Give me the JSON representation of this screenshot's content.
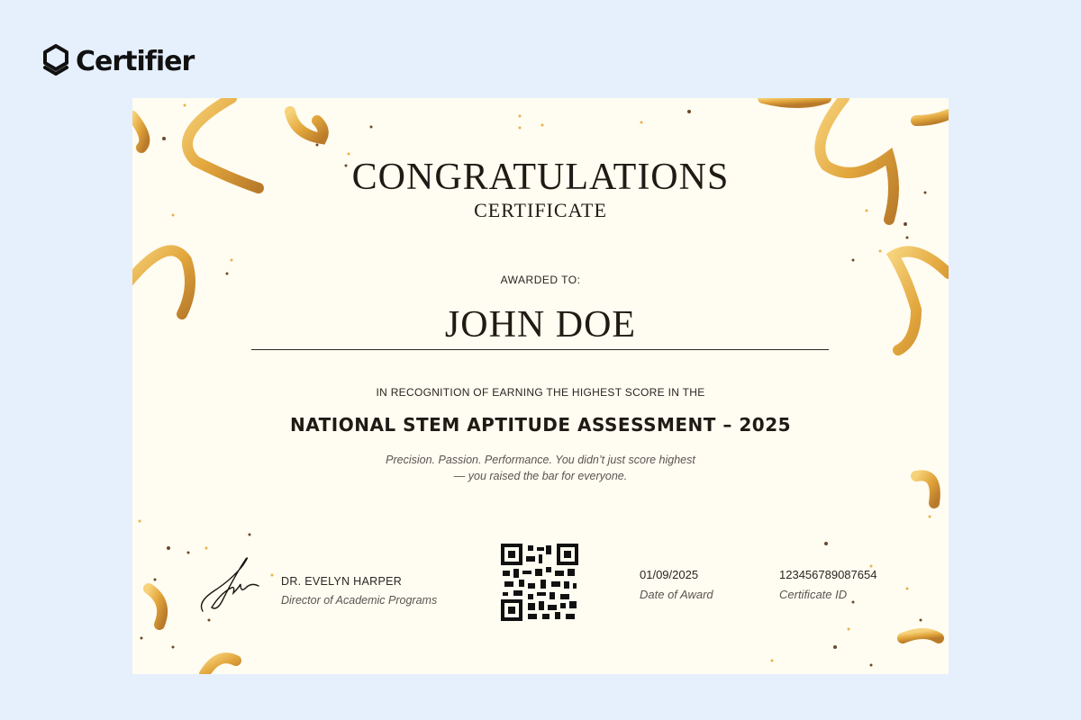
{
  "brand": {
    "name": "Certifier",
    "icon": "certifier-logo-icon"
  },
  "certificate": {
    "title": "CONGRATULATIONS",
    "subtitle": "CERTIFICATE",
    "awarded_label": "AWARDED TO:",
    "recipient_name": "JOHN DOE",
    "recognition_text": "IN RECOGNITION OF EARNING THE HIGHEST SCORE IN THE",
    "assessment_name": "NATIONAL STEM APTITUDE ASSESSMENT – 2025",
    "tagline_line1": "Precision. Passion. Performance. You didn’t just score highest",
    "tagline_line2": "— you raised the bar for everyone.",
    "signer_name": "DR. EVELYN HARPER",
    "signer_role": "Director of Academic Programs",
    "signature_icon": "signature-icon",
    "qr_icon": "qr-code-icon",
    "date_value": "01/09/2025",
    "date_label": "Date of Award",
    "certificate_id": "123456789087654",
    "certificate_id_label": "Certificate ID"
  },
  "colors": {
    "page_background": "#e6f0fd",
    "certificate_background": "#fffcf1",
    "ribbon_gold": "#e9b24a",
    "confetti_brown": "#6b4a2b",
    "text_dark": "#1f1a14"
  }
}
